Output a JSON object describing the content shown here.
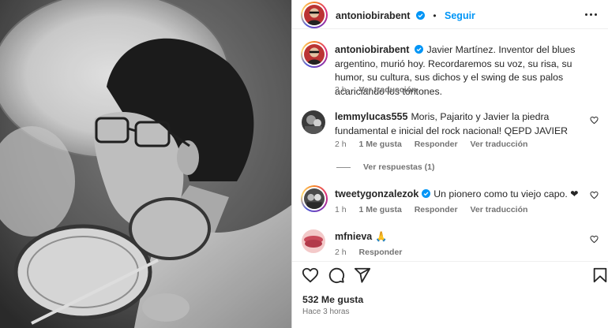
{
  "post": {
    "author": "antoniobirabent",
    "follow_label": "Seguir",
    "caption": "Javier Martínez. Inventor del blues argentino, murió hoy. Recordaremos su voz, su risa, su humor, su cultura, sus dichos y el swing de sus palos acariciando los tontones.",
    "caption_time": "3 h",
    "caption_translate": "Ver traducción"
  },
  "comments": [
    {
      "username": "lemmylucas555",
      "text": "Moris, Pajarito y Javier la piedra fundamental e inicial del rock nacional! QEPD JAVIER",
      "time": "2 h",
      "likes": "1 Me gusta",
      "reply": "Responder",
      "translate": "Ver traducción",
      "view_replies": "Ver respuestas (1)"
    },
    {
      "username": "tweetygonzalezok",
      "text": "Un pionero como tu viejo capo. ❤",
      "time": "1 h",
      "likes": "1 Me gusta",
      "reply": "Responder",
      "translate": "Ver traducción"
    },
    {
      "username": "mfnieva",
      "text": "🙏",
      "time": "2 h",
      "reply": "Responder"
    }
  ],
  "footer": {
    "likes_count": "532 Me gusta",
    "posted": "Hace 3 horas"
  },
  "icons": {
    "like": "heart-icon",
    "comment": "comment-icon",
    "share": "share-icon",
    "save": "bookmark-icon",
    "more": "more-options-icon",
    "verified": "verified-badge-icon"
  },
  "colors": {
    "link_blue": "#0095f6",
    "verified_blue": "#0095f6",
    "meta_gray": "#737373"
  }
}
